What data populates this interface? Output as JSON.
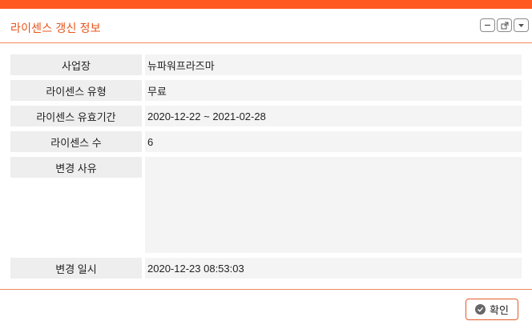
{
  "dialog": {
    "title": "라이센스 갱신 정보",
    "controls": [
      "minimize-icon",
      "popout-icon",
      "dropdown-icon"
    ]
  },
  "fields": [
    {
      "label": "사업장",
      "value": "뉴파워프라즈마"
    },
    {
      "label": "라이센스 유형",
      "value": "무료"
    },
    {
      "label": "라이센스 유효기간",
      "value": "2020-12-22 ~ 2021-02-28"
    },
    {
      "label": "라이센스 수",
      "value": "6"
    },
    {
      "label": "변경 사유",
      "value": ""
    },
    {
      "label": "변경 일시",
      "value": "2020-12-23 08:53:03"
    }
  ],
  "footer": {
    "confirm_label": "확인"
  },
  "colors": {
    "accent": "#ff5a1f",
    "border": "#f08a5d"
  }
}
